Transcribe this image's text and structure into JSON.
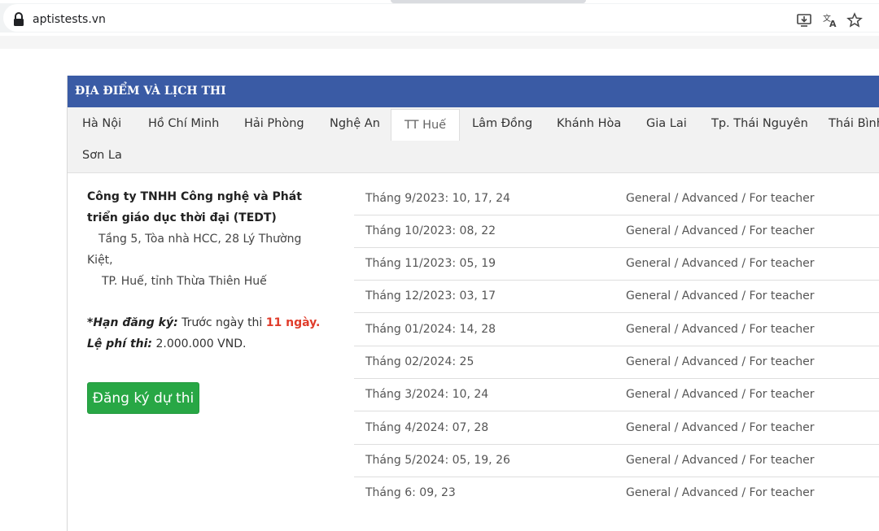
{
  "browser": {
    "url": "aptistests.vn"
  },
  "section": {
    "title": "ĐỊA ĐIỂM VÀ LỊCH THI"
  },
  "tabs": [
    {
      "label": "Hà Nội"
    },
    {
      "label": "Hồ Chí Minh"
    },
    {
      "label": "Hải Phòng"
    },
    {
      "label": "Nghệ An"
    },
    {
      "label": "TT Huế",
      "active": true
    },
    {
      "label": "Lâm Đồng"
    },
    {
      "label": "Khánh Hòa"
    },
    {
      "label": "Gia Lai"
    },
    {
      "label": "Tp. Thái Nguyên"
    },
    {
      "label": "Thái Bình"
    },
    {
      "label": "Sơn La"
    }
  ],
  "venue": {
    "company_name": "Công ty TNHH Công nghệ và Phát triển giáo dục thời đại (TEDT)",
    "address_line1": "Tầng 5, Tòa nhà HCC, 28 Lý Thường",
    "address_line2": "Kiệt,",
    "address_line3": "TP. Huế, tỉnh Thừa Thiên Huế",
    "deadline_label": "*Hạn đăng ký:",
    "deadline_text": " Trước ngày thi ",
    "deadline_value": "11 ngày.",
    "fee_label": "Lệ phí thi:",
    "fee_value": " 2.000.000 VND.",
    "register_button": "Đăng ký dự thi"
  },
  "schedule": [
    {
      "date": "Tháng 9/2023: 10, 17, 24",
      "level": "General / Advanced / For teacher"
    },
    {
      "date": "Tháng 10/2023: 08, 22",
      "level": "General / Advanced / For teacher"
    },
    {
      "date": "Tháng 11/2023: 05, 19",
      "level": "General / Advanced / For teacher"
    },
    {
      "date": "Tháng 12/2023: 03, 17",
      "level": "General / Advanced / For teacher"
    },
    {
      "date": "Tháng 01/2024: 14, 28",
      "level": "General / Advanced / For teacher"
    },
    {
      "date": "Tháng 02/2024: 25",
      "level": "General / Advanced / For teacher"
    },
    {
      "date": "Tháng 3/2024: 10, 24",
      "level": "General / Advanced / For teacher"
    },
    {
      "date": "Tháng 4/2024: 07, 28",
      "level": "General / Advanced / For teacher"
    },
    {
      "date": "Tháng 5/2024: 05, 19, 26",
      "level": "General / Advanced / For teacher"
    },
    {
      "date": "Tháng 6: 09, 23",
      "level": "General / Advanced / For teacher"
    }
  ],
  "colors": {
    "header_bg": "#3a5ba5",
    "button_bg": "#28a745",
    "deadline_red": "#e03c2b"
  }
}
